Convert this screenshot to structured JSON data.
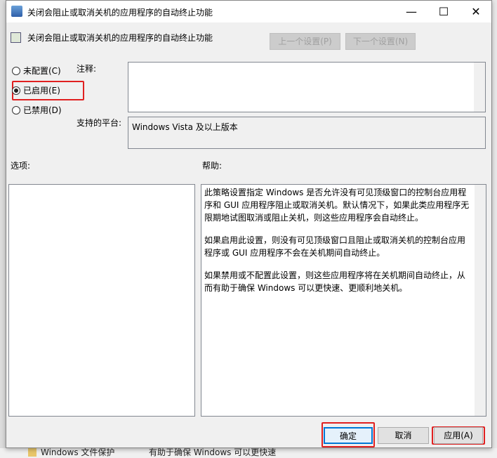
{
  "window": {
    "title": "关闭会阻止或取消关机的应用程序的自动终止功能",
    "minimize": "—",
    "maximize": "☐",
    "close": "✕"
  },
  "header": {
    "policy_name": "关闭会阻止或取消关机的应用程序的自动终止功能",
    "prev_button": "上一个设置(P)",
    "next_button": "下一个设置(N)"
  },
  "state": {
    "options": [
      {
        "label": "未配置(C)",
        "selected": false
      },
      {
        "label": "已启用(E)",
        "selected": true
      },
      {
        "label": "已禁用(D)",
        "selected": false
      }
    ]
  },
  "comment": {
    "label": "注释:",
    "value": ""
  },
  "platform": {
    "label": "支持的平台:",
    "value": "Windows Vista 及以上版本"
  },
  "options_label": "选项:",
  "help_label": "帮助:",
  "help_paragraphs": [
    "此策略设置指定 Windows 是否允许没有可见顶级窗口的控制台应用程序和 GUI 应用程序阻止或取消关机。默认情况下，如果此类应用程序无限期地试图取消或阻止关机，则这些应用程序会自动终止。",
    "如果启用此设置，则没有可见顶级窗口且阻止或取消关机的控制台应用程序或 GUI 应用程序不会在关机期间自动终止。",
    "如果禁用或不配置此设置，则这些应用程序将在关机期间自动终止，从而有助于确保 Windows 可以更快速、更顺利地关机。"
  ],
  "buttons": {
    "ok": "确定",
    "cancel": "取消",
    "apply": "应用(A)"
  },
  "background": {
    "tree_item": "Windows 文件保护",
    "text": "有助于确保 Windows 可以更快速"
  },
  "colors": {
    "highlight": "#e02020",
    "focus": "#0078d7"
  }
}
